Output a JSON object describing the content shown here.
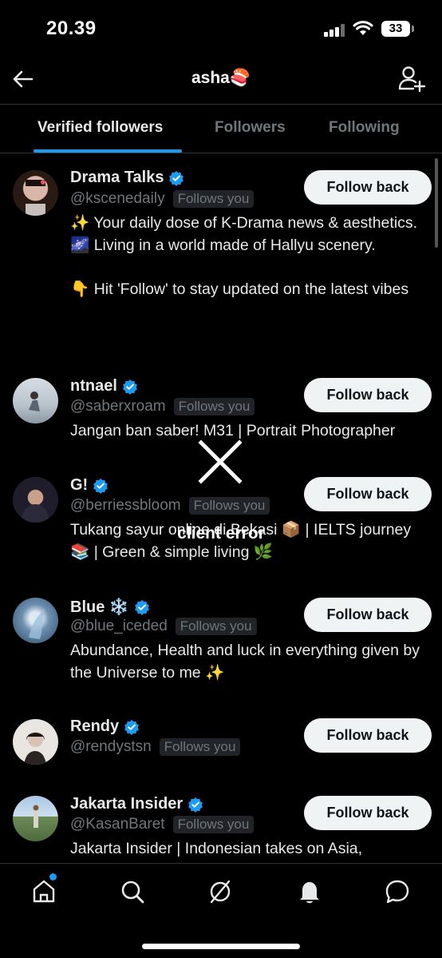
{
  "status_bar": {
    "time": "20.39",
    "battery": "33"
  },
  "header": {
    "title": "asha🍣"
  },
  "tabs": [
    {
      "label": "Verified followers"
    },
    {
      "label": "Followers"
    },
    {
      "label": "Following"
    }
  ],
  "users": [
    {
      "name": "Drama Talks",
      "handle": "@kscenedaily",
      "follows_label": "Follows you",
      "bio": "✨ Your daily dose of K-Drama news & aesthetics.\n🌌 Living in a world made of Hallyu scenery.\n\n👇 Hit 'Follow' to stay updated on the latest vibes",
      "button": "Follow back"
    },
    {
      "name": "ntnael",
      "handle": "@saberxroam",
      "follows_label": "Follows you",
      "bio": "Jangan ban saber! M31 | Portrait Photographer",
      "button": "Follow back"
    },
    {
      "name": "G!",
      "handle": "@berriessbloom",
      "follows_label": "Follows you",
      "bio": "Tukang sayur online di Bekasi 📦 | IELTS journey 📚 | Green & simple living 🌿",
      "button": "Follow back"
    },
    {
      "name": "Blue ❄️",
      "handle": "@blue_iceded",
      "follows_label": "Follows you",
      "bio": "Abundance, Health and luck in everything given by the Universe to me ✨",
      "button": "Follow back"
    },
    {
      "name": "Rendy",
      "handle": "@rendystsn",
      "follows_label": "Follows you",
      "bio": "",
      "button": "Follow back"
    },
    {
      "name": "Jakarta Insider",
      "handle": "@KasanBaret",
      "follows_label": "Follows you",
      "bio": "Jakarta Insider | Indonesian takes on Asia,",
      "button": "Follow back"
    }
  ],
  "error": {
    "text": "client error"
  },
  "colors": {
    "accent": "#1d9bf0",
    "background": "#000000",
    "muted": "#71767b"
  },
  "icons": [
    "back-icon",
    "add-user-icon",
    "verified-icon",
    "home-icon",
    "search-icon",
    "grok-icon",
    "bell-icon",
    "messages-icon",
    "error-x-icon"
  ]
}
